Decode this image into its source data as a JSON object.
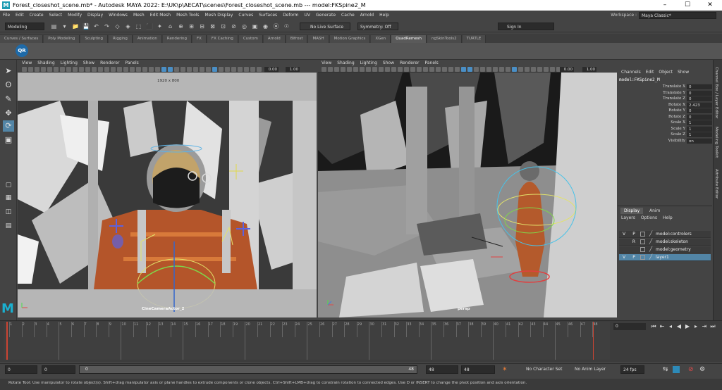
{
  "titlebar": {
    "title": "Forest_closeshot_scene.mb* - Autodesk MAYA 2022: E:\\UK\\p\\AECAT\\scenes\\Forest_closeshot_scene.mb   ---   model:FKSpine2_M",
    "logo": "M",
    "minimize": "–",
    "maximize": "☐",
    "close": "✕"
  },
  "menubar": {
    "items": [
      "File",
      "Edit",
      "Create",
      "Select",
      "Modify",
      "Display",
      "Windows",
      "Mesh",
      "Edit Mesh",
      "Mesh Tools",
      "Mesh Display",
      "Curves",
      "Surfaces",
      "Deform",
      "UV",
      "Generate",
      "Cache",
      "Arnold",
      "Help"
    ],
    "workspace_label": "Workspace :",
    "workspace_value": "Maya Classic*"
  },
  "statusline": {
    "mode": "Modeling",
    "live_surface": "No Live Surface",
    "symmetry": "Symmetry: Off",
    "sign_in": "Sign In"
  },
  "shelf": {
    "tabs": [
      "Curves / Surfaces",
      "Poly Modeling",
      "Sculpting",
      "Rigging",
      "Animation",
      "Rendering",
      "FX",
      "FX Caching",
      "Custom",
      "Arnold",
      "Bifrost",
      "MASH",
      "Motion Graphics",
      "XGen",
      "QuadRemesh",
      "ngSkinTools2",
      "TURTLE"
    ],
    "active_tab": "QuadRemesh",
    "qr_button": "QR"
  },
  "viewport_left": {
    "menus": [
      "View",
      "Shading",
      "Lighting",
      "Show",
      "Renderer",
      "Panels"
    ],
    "near_clip": "0.00",
    "far_clip": "1.00",
    "resolution_gate": "1920 x 800",
    "camera_name": "CineCameraActor_2"
  },
  "viewport_right": {
    "menus": [
      "View",
      "Shading",
      "Lighting",
      "Show",
      "Renderer",
      "Panels"
    ],
    "near_clip": "0.00",
    "far_clip": "1.00",
    "camera_name": "persp"
  },
  "channel_box": {
    "menus": [
      "Channels",
      "Edit",
      "Object",
      "Show"
    ],
    "object_name": "model:FKSpine2_M",
    "channels": [
      {
        "label": "Translate X",
        "value": "0"
      },
      {
        "label": "Translate Y",
        "value": "0"
      },
      {
        "label": "Translate Z",
        "value": "0"
      },
      {
        "label": "Rotate X",
        "value": "2.423"
      },
      {
        "label": "Rotate Y",
        "value": "0"
      },
      {
        "label": "Rotate Z",
        "value": "0"
      },
      {
        "label": "Scale X",
        "value": "1"
      },
      {
        "label": "Scale Y",
        "value": "1"
      },
      {
        "label": "Scale Z",
        "value": "1"
      },
      {
        "label": "Visibility",
        "value": "on"
      }
    ]
  },
  "side_tabs": [
    "Channel Box / Layer Editor",
    "Modeling Toolkit",
    "Attribute Editor"
  ],
  "layer_editor": {
    "tabs": [
      "Display",
      "Anim"
    ],
    "menus": [
      "Layers",
      "Options",
      "Help"
    ],
    "layers": [
      {
        "v": "V",
        "p": "P",
        "name": "model:controlers",
        "selected": false
      },
      {
        "v": "",
        "p": "R",
        "name": "model:skeleton",
        "selected": false
      },
      {
        "v": "",
        "p": "",
        "name": "model:geometry",
        "selected": false
      },
      {
        "v": "V",
        "p": "P",
        "name": "layer1",
        "selected": true
      }
    ]
  },
  "timeline": {
    "ticks": [
      "1",
      "2",
      "3",
      "4",
      "5",
      "6",
      "7",
      "8",
      "9",
      "10",
      "11",
      "12",
      "13",
      "14",
      "15",
      "16",
      "17",
      "18",
      "19",
      "20",
      "21",
      "22",
      "23",
      "24",
      "25",
      "26",
      "27",
      "28",
      "29",
      "30",
      "31",
      "32",
      "33",
      "34",
      "35",
      "36",
      "37",
      "38",
      "39",
      "40",
      "41",
      "42",
      "43",
      "44",
      "45",
      "46",
      "47",
      "48"
    ],
    "current_frame": "0"
  },
  "range": {
    "start": "0",
    "anim_start": "0",
    "range_start_label": "0",
    "range_end_label": "48",
    "end": "48",
    "anim_end": "48",
    "character_set": "No Character Set",
    "anim_layer": "No Anim Layer",
    "fps": "24 fps"
  },
  "help_line": "Rotate Tool: Use manipulator to rotate object(s). Shift+drag manipulator axis or plane handles to extrude components or clone objects. Ctrl+Shift+LMB+drag to constrain rotation to connected edges. Use D or INSERT to change the pivot position and axis orientation.",
  "colors": {
    "accent": "#5285a6",
    "maya_teal": "#1ab0d0",
    "playhead": "#cc4433"
  }
}
